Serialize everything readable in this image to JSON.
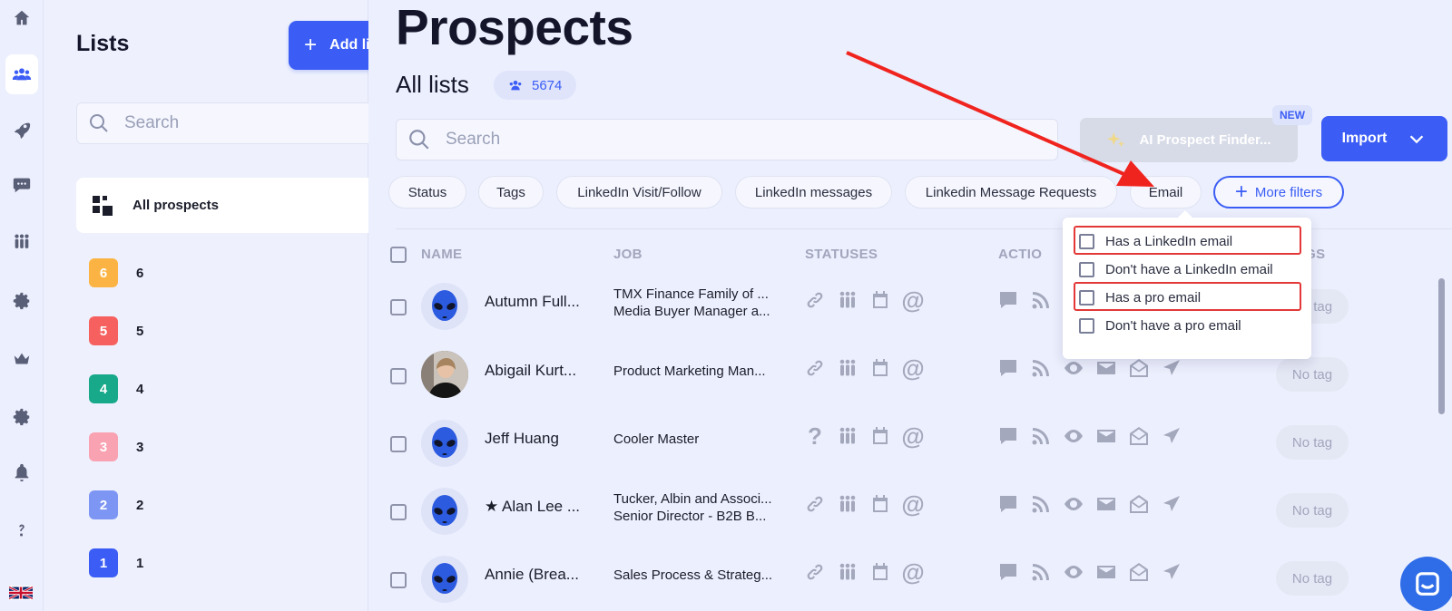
{
  "rail": {
    "items": [
      "home-icon",
      "users-icon",
      "rocket-icon",
      "chat-icon",
      "team-icon",
      "settings-icon",
      "crown-icon",
      "cog-icon",
      "bell-icon",
      "help-icon"
    ],
    "active": "users-icon",
    "language_flag": "uk-flag-icon"
  },
  "lists_panel": {
    "title": "Lists",
    "add_button": "Add list",
    "search_placeholder": "Search",
    "all_prospects": "All prospects",
    "items": [
      {
        "badge": "6",
        "label": "6",
        "color": "#fbb444"
      },
      {
        "badge": "5",
        "label": "5",
        "color": "#f6615f"
      },
      {
        "badge": "4",
        "label": "4",
        "color": "#17a98a"
      },
      {
        "badge": "3",
        "label": "3",
        "color": "#f9a2b1"
      },
      {
        "badge": "2",
        "label": "2",
        "color": "#7e96f3"
      },
      {
        "badge": "1",
        "label": "1",
        "color": "#3b5df5"
      }
    ]
  },
  "header": {
    "title": "Prospects",
    "subtitle": "All lists",
    "count": "5674"
  },
  "toolbar": {
    "search_placeholder": "Search",
    "ai_finder": "AI Prospect Finder...",
    "new_badge": "NEW",
    "import": "Import"
  },
  "filters": [
    "Status",
    "Tags",
    "LinkedIn Visit/Follow",
    "LinkedIn messages",
    "Linkedin Message Requests",
    "Email"
  ],
  "more_filters": "More filters",
  "table": {
    "headers": {
      "name": "NAME",
      "job": "JOB",
      "statuses": "STATUSES",
      "actions": "ACTIO",
      "tags": "AGS"
    },
    "rows": [
      {
        "name": "Autumn Full...",
        "job1": "TMX Finance Family of ...",
        "job2": "Media Buyer Manager a...",
        "first_status": "link",
        "tag": "No tag",
        "avatar": "alien"
      },
      {
        "name": "Abigail Kurt...",
        "job1": "Product Marketing Man...",
        "job2": "",
        "first_status": "link",
        "tag": "No tag",
        "avatar": "photo"
      },
      {
        "name": "Jeff Huang",
        "job1": "Cooler Master",
        "job2": "",
        "first_status": "?",
        "tag": "No tag",
        "avatar": "alien"
      },
      {
        "name": "★ Alan Lee ...",
        "job1": "Tucker, Albin and Associ...",
        "job2": "Senior Director - B2B B...",
        "first_status": "link",
        "tag": "No tag",
        "avatar": "alien"
      },
      {
        "name": "Annie (Brea...",
        "job1": "Sales Process & Strateg...",
        "job2": "",
        "first_status": "link",
        "tag": "No tag",
        "avatar": "alien"
      }
    ]
  },
  "email_dropdown": {
    "options": [
      "Has a LinkedIn email",
      "Don't have a LinkedIn email",
      "Has a pro email",
      "Don't have a pro email"
    ],
    "highlighted": [
      "Has a LinkedIn email",
      "Has a pro email"
    ]
  },
  "colors": {
    "accent": "#3b5df5",
    "annotation": "#e43838"
  }
}
